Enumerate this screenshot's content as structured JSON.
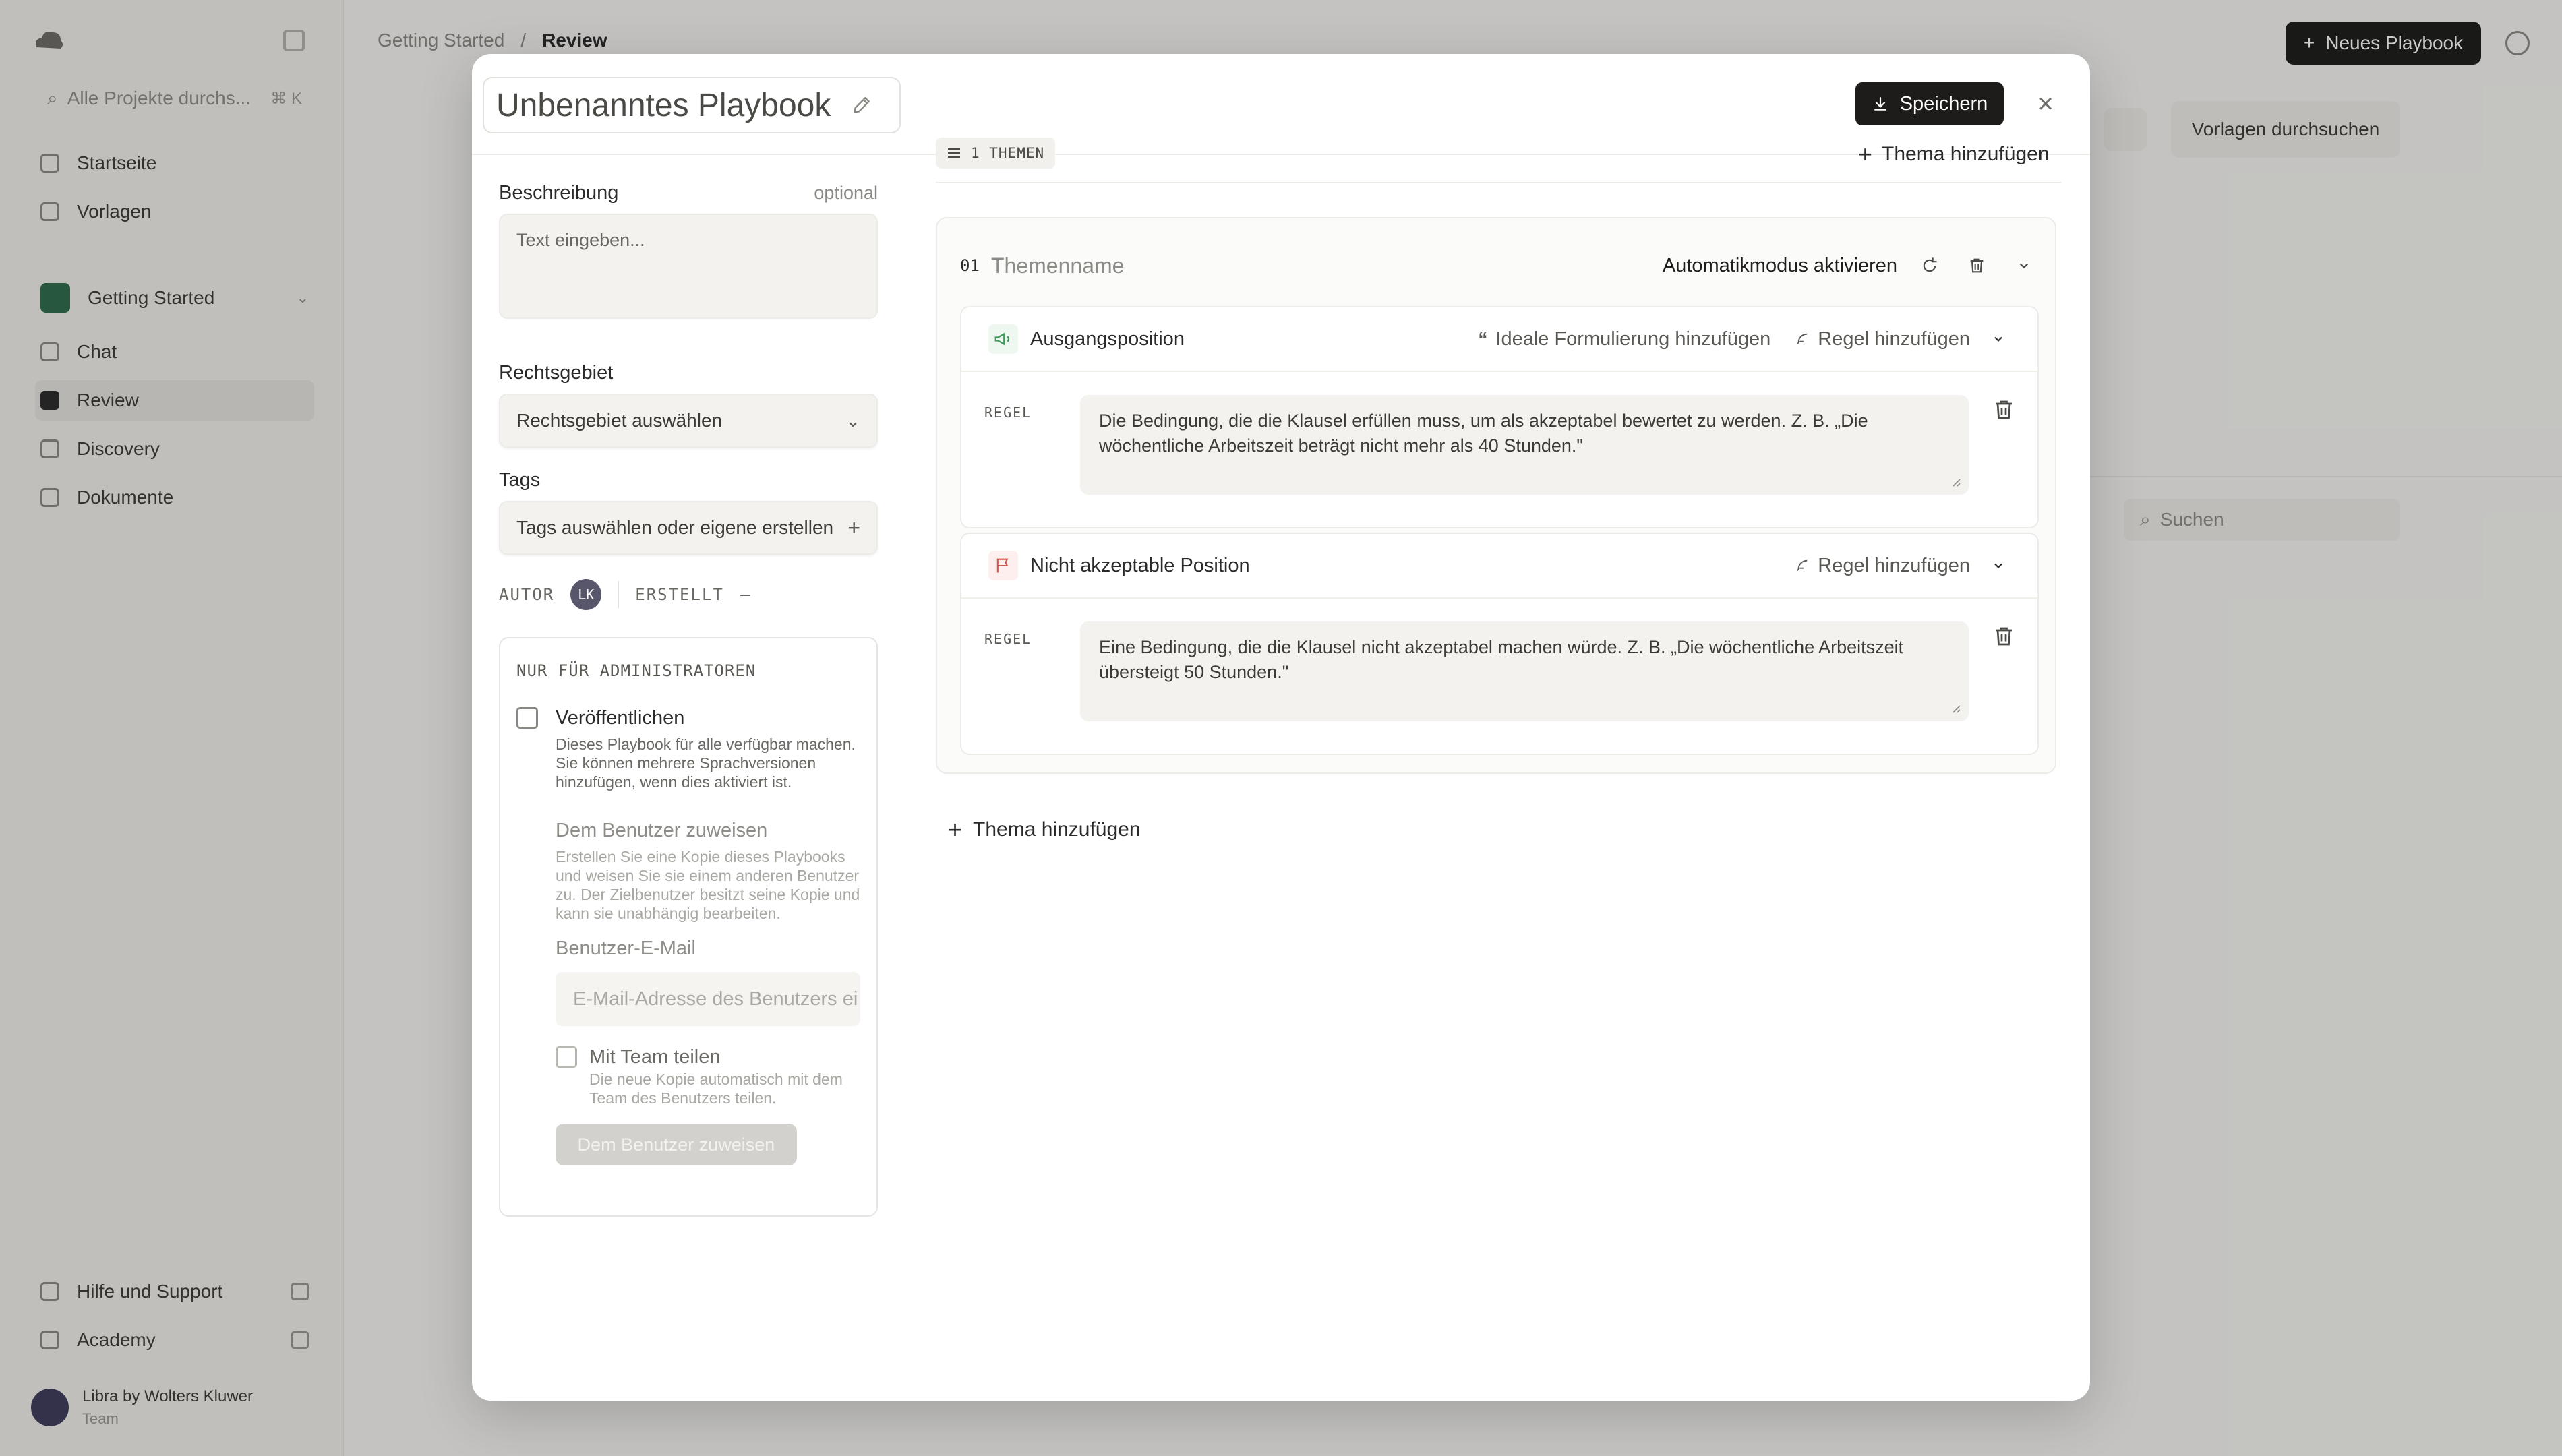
{
  "background": {
    "search_placeholder": "Alle Projekte durchs...",
    "search_shortcut": "⌘ K",
    "nav": [
      {
        "label": "Startseite"
      },
      {
        "label": "Vorlagen"
      }
    ],
    "project": {
      "label": "Getting Started"
    },
    "project_nav": [
      {
        "label": "Chat"
      },
      {
        "label": "Review"
      },
      {
        "label": "Discovery"
      },
      {
        "label": "Dokumente"
      }
    ],
    "footer_nav": [
      {
        "label": "Hilfe und Support"
      },
      {
        "label": "Academy"
      }
    ],
    "user": {
      "name": "Libra by Wolters Kluwer",
      "sub": "Team"
    },
    "breadcrumb": {
      "root": "Getting Started",
      "sep": "/",
      "current": "Review"
    },
    "new_playbook_label": "Neues Playbook",
    "browse_templates_label": "Vorlagen durchsuchen",
    "search2_placeholder": "Suchen"
  },
  "modal": {
    "title": "Unbenanntes Playbook",
    "save_label": "Speichern",
    "close_glyph": "×",
    "description": {
      "label": "Beschreibung",
      "optional": "optional",
      "placeholder": "Text eingeben..."
    },
    "jurisdiction": {
      "label": "Rechtsgebiet",
      "placeholder": "Rechtsgebiet auswählen"
    },
    "tags": {
      "label": "Tags",
      "placeholder": "Tags auswählen oder eigene erstellen"
    },
    "meta": {
      "author_label": "AUTOR",
      "author_initials": "LK",
      "created_label": "ERSTELLT",
      "created_value": "–"
    },
    "admin": {
      "title": "NUR FÜR ADMINISTRATOREN",
      "publish_title": "Veröffentlichen",
      "publish_desc": "Dieses Playbook für alle verfügbar machen. Sie können mehrere Sprachversionen hinzufügen, wenn dies aktiviert ist.",
      "assign_title": "Dem Benutzer zuweisen",
      "assign_desc": "Erstellen Sie eine Kopie dieses Playbooks und weisen Sie sie einem anderen Benutzer zu. Der Zielbenutzer besitzt seine Kopie und kann sie unabhängig bearbeiten.",
      "email_label": "Benutzer-E-Mail",
      "email_placeholder": "E-Mail-Adresse des Benutzers ei",
      "team_title": "Mit Team teilen",
      "team_desc": "Die neue Kopie automatisch mit dem Team des Benutzers teilen.",
      "assign_button": "Dem Benutzer zuweisen"
    },
    "themes": {
      "count_label": "1 THEMEN",
      "add_label": "Thema hinzufügen",
      "items": [
        {
          "number": "01",
          "name_placeholder": "Themenname",
          "auto_mode_label": "Automatikmodus aktivieren",
          "positions": [
            {
              "title": "Ausgangsposition",
              "ideal_label": "Ideale Formulierung hinzufügen",
              "rule_add_label": "Regel hinzufügen",
              "rule_label": "REGEL",
              "rule_placeholder": "Die Bedingung, die die Klausel erfüllen muss, um als akzeptabel bewertet zu werden. Z. B. „Die wöchentliche Arbeitszeit beträgt nicht mehr als 40 Stunden.\"",
              "accent": "#3f9a5b"
            },
            {
              "title": "Nicht akzeptable Position",
              "rule_add_label": "Regel hinzufügen",
              "rule_label": "REGEL",
              "rule_placeholder": "Eine Bedingung, die die Klausel nicht akzeptabel machen würde. Z. B. „Die wöchentliche Arbeitszeit übersteigt 50 Stunden.\"",
              "accent": "#d9534f"
            }
          ]
        }
      ]
    }
  }
}
